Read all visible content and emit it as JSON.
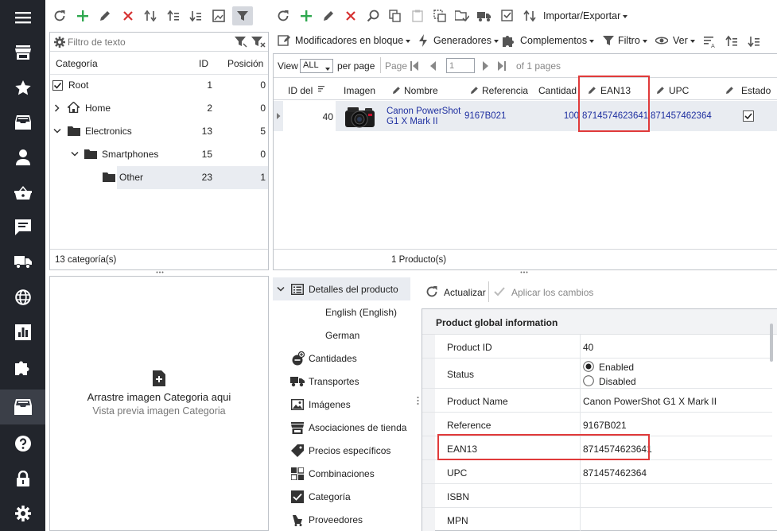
{
  "nav": {
    "items": [
      {
        "icon": "menu-icon"
      },
      {
        "icon": "store-icon"
      },
      {
        "icon": "star-icon"
      },
      {
        "icon": "inbox-icon"
      },
      {
        "icon": "user-icon"
      },
      {
        "icon": "basket-icon"
      },
      {
        "icon": "message-icon"
      },
      {
        "icon": "truck-icon"
      },
      {
        "icon": "globe-icon"
      },
      {
        "icon": "chart-icon"
      },
      {
        "icon": "puzzle-icon"
      },
      {
        "icon": "catalog-icon"
      },
      {
        "icon": "help-icon"
      },
      {
        "icon": "lock-icon"
      },
      {
        "icon": "gear-icon"
      }
    ],
    "active_index": 11
  },
  "categories": {
    "filter_placeholder": "Filtro de texto",
    "columns": {
      "category": "Categoría",
      "id": "ID",
      "position": "Posición"
    },
    "rows": [
      {
        "label": "Root",
        "id": "1",
        "position": "0"
      },
      {
        "label": "Home",
        "id": "2",
        "position": "0"
      },
      {
        "label": "Electronics",
        "id": "13",
        "position": "5"
      },
      {
        "label": "Smartphones",
        "id": "15",
        "position": "0"
      },
      {
        "label": "Other",
        "id": "23",
        "position": "1"
      }
    ],
    "footer": "13 categoría(s)"
  },
  "image_drop": {
    "title": "Arrastre imagen Categoria aqui",
    "subtitle": "Vista previa imagen Categoria"
  },
  "products": {
    "toolbar": {
      "import_export": "Importar/Exportar",
      "bulk_modifiers": "Modificadores en bloque",
      "generators": "Generadores",
      "addons": "Complementos",
      "filter": "Filtro",
      "view": "Ver"
    },
    "pager": {
      "view_label": "View",
      "view_value": "ALL",
      "per_page": "per page",
      "page_label": "Page",
      "page_value": "1",
      "of_pages": "of 1 pages"
    },
    "columns": {
      "id": "ID del",
      "image": "Imagen",
      "name": "Nombre",
      "reference": "Referencia",
      "quantity": "Cantidad",
      "ean13": "EAN13",
      "upc": "UPC",
      "status": "Estado"
    },
    "row": {
      "id": "40",
      "name": "Canon PowerShot G1 X Mark II",
      "reference": "9167B021",
      "quantity": "100",
      "ean13": "8714574623641",
      "upc": "871457462364"
    },
    "footer": "1 Producto(s)"
  },
  "detail_nav": {
    "items": [
      {
        "label": "Detalles del producto",
        "icon": "list-icon"
      },
      {
        "label": "English (English)",
        "icon": ""
      },
      {
        "label": "German",
        "icon": ""
      },
      {
        "label": "Cantidades",
        "icon": "quantity-icon"
      },
      {
        "label": "Transportes",
        "icon": "truck-icon"
      },
      {
        "label": "Imágenes",
        "icon": "image-icon"
      },
      {
        "label": "Asociaciones de tienda",
        "icon": "shop-icon"
      },
      {
        "label": "Precios específicos",
        "icon": "tag-icon"
      },
      {
        "label": "Combinaciones",
        "icon": "grid-icon"
      },
      {
        "label": "Categoría",
        "icon": "check-box-icon"
      },
      {
        "label": "Proveedores",
        "icon": "supplier-icon"
      }
    ]
  },
  "details": {
    "refresh": "Actualizar",
    "apply": "Aplicar los cambios",
    "section": "Product global information",
    "rows": [
      {
        "key": "Product ID",
        "value": "40"
      },
      {
        "key": "Status",
        "value": ""
      },
      {
        "key": "Product Name",
        "value": "Canon PowerShot G1 X Mark II"
      },
      {
        "key": "Reference",
        "value": "9167B021"
      },
      {
        "key": "EAN13",
        "value": "8714574623641"
      },
      {
        "key": "UPC",
        "value": "871457462364"
      },
      {
        "key": "ISBN",
        "value": ""
      },
      {
        "key": "MPN",
        "value": ""
      }
    ],
    "status_options": {
      "enabled": "Enabled",
      "disabled": "Disabled"
    }
  },
  "colors": {
    "nav_bg": "#22252c",
    "accent_green": "#2fa84f",
    "accent_red": "#d63030",
    "highlight_red": "#e03a3a",
    "link_blue": "#1e2fa0",
    "selected_row": "#e9ecf1"
  }
}
